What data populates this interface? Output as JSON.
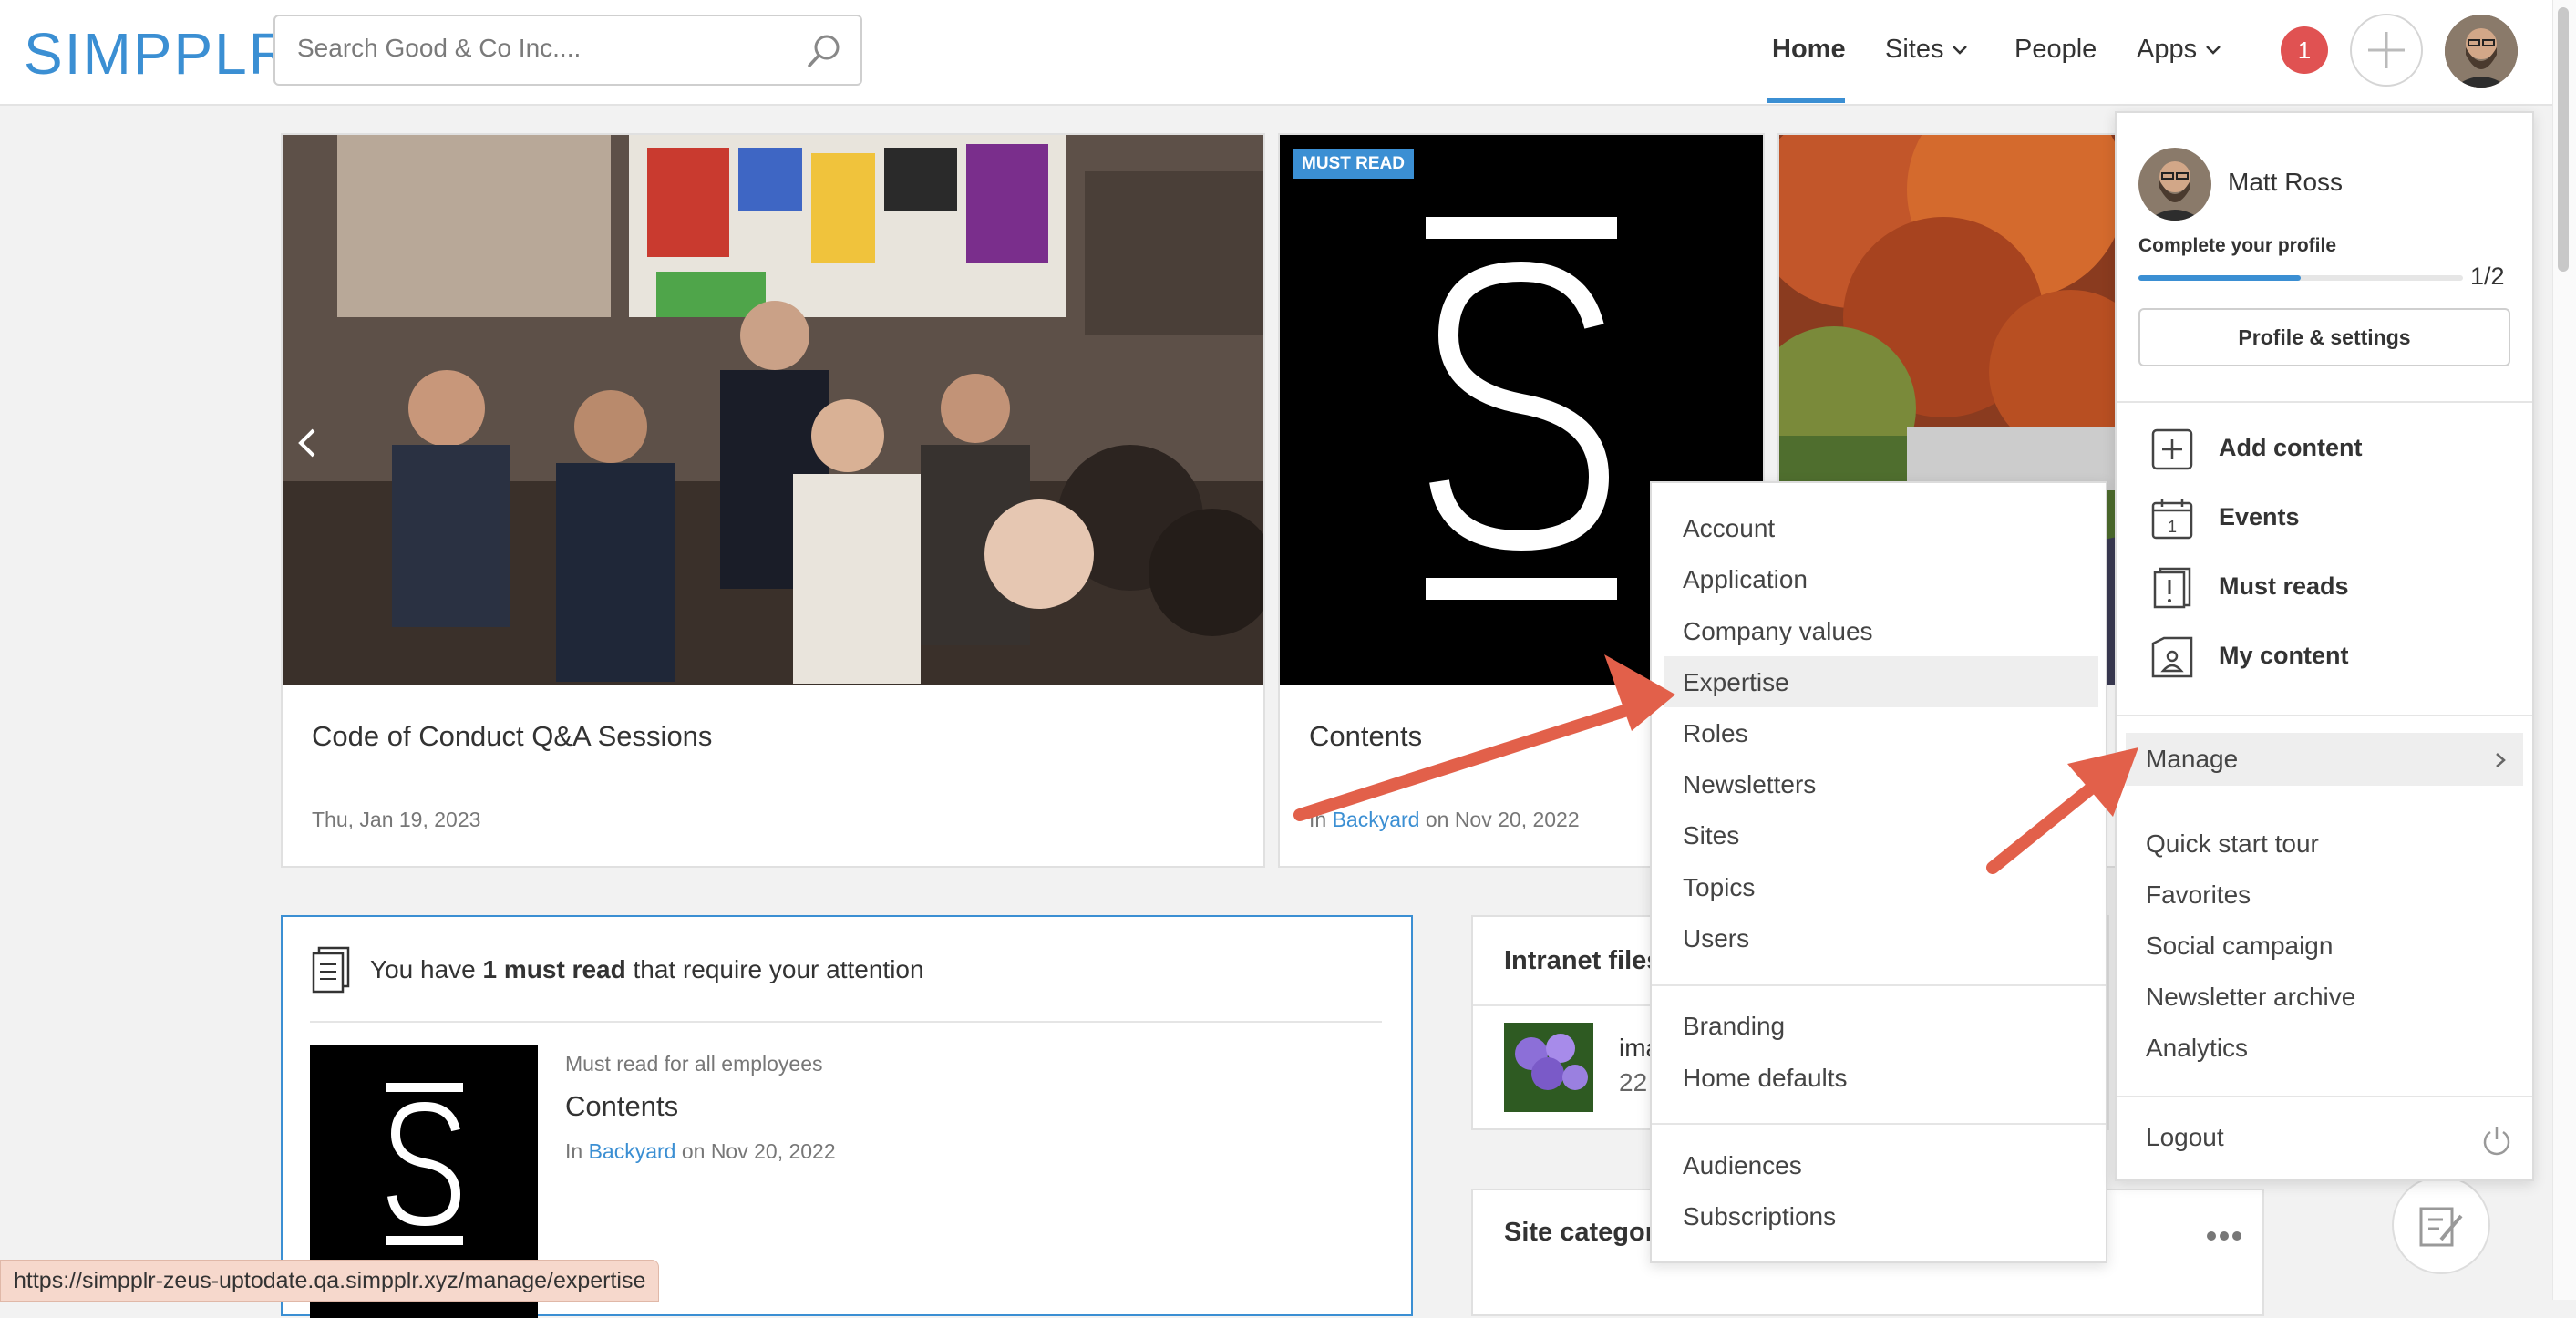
{
  "header": {
    "logo": "SIMPPLR",
    "search_placeholder": "Search Good & Co Inc....",
    "nav": {
      "home": "Home",
      "sites": "Sites",
      "people": "People",
      "apps": "Apps"
    },
    "notification_count": "1"
  },
  "carousel": {
    "cards": [
      {
        "title": "Code of Conduct Q&A Sessions",
        "date": "Thu, Jan 19, 2023"
      },
      {
        "badge": "MUST READ",
        "title": "Contents",
        "meta_in": "In",
        "meta_site": "Backyard",
        "meta_on": "on Nov 20, 2022"
      }
    ]
  },
  "must_read_panel": {
    "text_prefix": "You have",
    "text_bold": "1 must read",
    "text_suffix": "that require your attention",
    "item": {
      "label": "Must read for all employees",
      "title": "Contents",
      "meta_in": "In",
      "meta_site": "Backyard",
      "meta_on": "on Nov 20, 2022"
    }
  },
  "intranet_files": {
    "title": "Intranet files",
    "file_name": "ima",
    "file_meta": "22"
  },
  "site_categories": {
    "title": "Site categor"
  },
  "manage_submenu": {
    "items_group1": [
      "Account",
      "Application",
      "Company values",
      "Expertise",
      "Roles",
      "Newsletters",
      "Sites",
      "Topics",
      "Users"
    ],
    "items_group2": [
      "Branding",
      "Home defaults"
    ],
    "items_group3": [
      "Audiences",
      "Subscriptions"
    ],
    "highlighted": "Expertise"
  },
  "profile_menu": {
    "name": "Matt Ross",
    "complete_label": "Complete your profile",
    "progress_text": "1/2",
    "progress_fraction": 0.5,
    "settings_button": "Profile & settings",
    "actions": [
      {
        "label": "Add content",
        "icon": "plus-box-icon"
      },
      {
        "label": "Events",
        "icon": "calendar-icon"
      },
      {
        "label": "Must reads",
        "icon": "exclamation-doc-icon"
      },
      {
        "label": "My content",
        "icon": "user-doc-icon"
      }
    ],
    "manage": "Manage",
    "links": [
      "Quick start tour",
      "Favorites",
      "Social campaign",
      "Newsletter archive",
      "Analytics"
    ],
    "logout": "Logout"
  },
  "status_bar": {
    "url": "https://simpplr-zeus-uptodate.qa.simpplr.xyz/manage/expertise"
  },
  "colors": {
    "brand": "#3b8fd3",
    "notification": "#e05252",
    "arrow": "#e2604a",
    "badge": "#3b8fd3"
  }
}
